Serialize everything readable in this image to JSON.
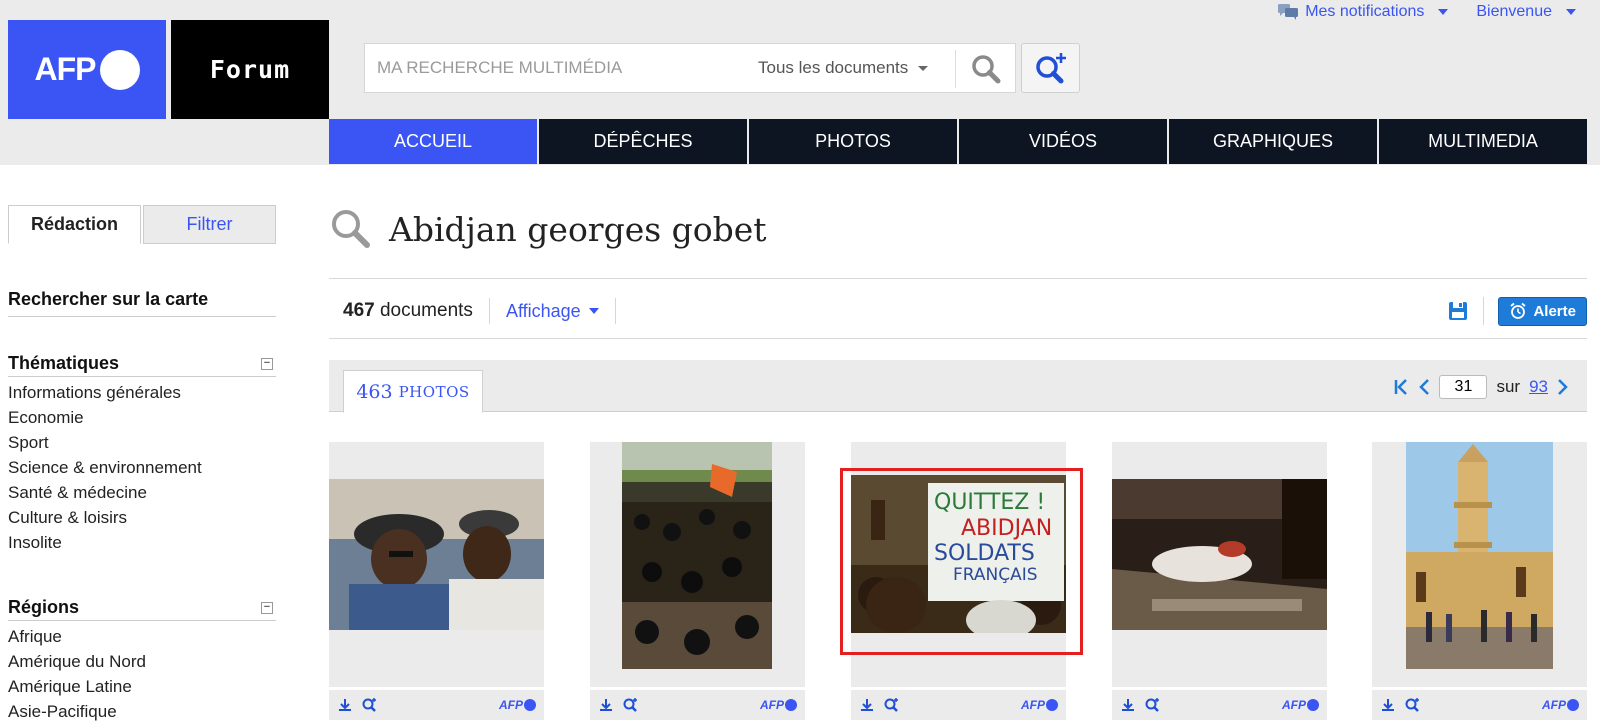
{
  "header": {
    "logo_text": "AFP",
    "forum_text": "Forum",
    "search": {
      "placeholder": "MA RECHERCHE MULTIMÉDIA",
      "scope": "Tous les documents"
    },
    "notifications": "Mes notifications",
    "welcome": "Bienvenue"
  },
  "nav": {
    "tabs": [
      {
        "label": "ACCUEIL",
        "active": true
      },
      {
        "label": "DÉPÊCHES",
        "active": false
      },
      {
        "label": "PHOTOS",
        "active": false
      },
      {
        "label": "VIDÉOS",
        "active": false
      },
      {
        "label": "GRAPHIQUES",
        "active": false
      },
      {
        "label": "MULTIMEDIA",
        "active": false
      }
    ]
  },
  "sidebar": {
    "tabs": [
      "Rédaction",
      "Filtrer"
    ],
    "map_link": "Rechercher sur la carte",
    "thematiques": {
      "title": "Thématiques",
      "items": [
        "Informations générales",
        "Economie",
        "Sport",
        "Science & environnement",
        "Santé & médecine",
        "Culture & loisirs",
        "Insolite"
      ]
    },
    "regions": {
      "title": "Régions",
      "items": [
        "Afrique",
        "Amérique du Nord",
        "Amérique Latine",
        "Asie-Pacifique"
      ]
    }
  },
  "main": {
    "query": "Abidjan georges gobet",
    "count_number": "467",
    "count_label": " documents",
    "affichage": "Affichage",
    "alerte": "Alerte",
    "photos_count": "463",
    "photos_label": "PHOTOS",
    "pager": {
      "current": "31",
      "sur": "sur",
      "total": "93"
    },
    "photos": [
      {
        "name": "photo-men-in-hats",
        "selected": false
      },
      {
        "name": "photo-crowd-road",
        "selected": false
      },
      {
        "name": "photo-quittez-abidjan-sign",
        "selected": true,
        "sign_text": "QUITTEZ ! ABIDJAN SOLDATS FRANÇAIS"
      },
      {
        "name": "photo-body-stretcher",
        "selected": false
      },
      {
        "name": "photo-mosque-minaret",
        "selected": false
      }
    ],
    "photo_badge": "AFP"
  },
  "colors": {
    "brand_blue": "#3a55f3",
    "nav_dark": "#0d1522",
    "selection_red": "#e41f1f"
  }
}
